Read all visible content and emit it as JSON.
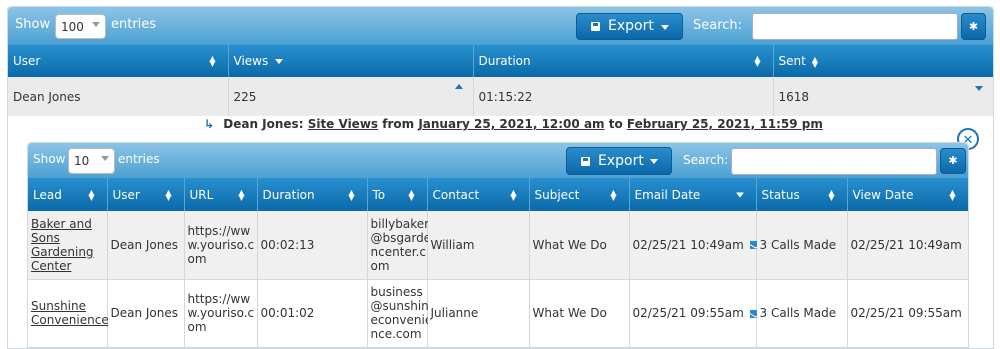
{
  "outer_toolbar": {
    "show_label": "Show",
    "entries_value": "100",
    "entries_label": "entries",
    "export_label": "Export",
    "search_label": "Search:",
    "search_value": ""
  },
  "outer_table": {
    "columns": [
      "User",
      "Views",
      "Duration",
      "Sent"
    ],
    "row": {
      "user": "Dean Jones",
      "views": "225",
      "duration": "01:15:22",
      "sent": "1618"
    }
  },
  "detail": {
    "user": "Dean Jones:",
    "metric": "Site Views",
    "from_word": "from",
    "start": "January 25, 2021, 12:00 am",
    "to_word": "to",
    "end": "February 25, 2021, 11:59 pm"
  },
  "inner_toolbar": {
    "show_label": "Show",
    "entries_value": "10",
    "entries_label": "entries",
    "export_label": "Export",
    "search_label": "Search:",
    "search_value": ""
  },
  "inner_table": {
    "columns": [
      "Lead",
      "User",
      "URL",
      "Duration",
      "To",
      "Contact",
      "Subject",
      "Email Date",
      "Status",
      "View Date"
    ],
    "rows": [
      {
        "lead": [
          "Baker and",
          "Sons",
          "Gardening",
          "Center"
        ],
        "user": "Dean Jones",
        "url": [
          "https://ww",
          "w.youriso.c",
          "om"
        ],
        "duration": "00:02:13",
        "to": [
          "billybaker",
          "@bsgarde",
          "ncenter.c",
          "om"
        ],
        "contact": "William",
        "subject": "What We Do",
        "email_date": "02/25/21 10:49am",
        "status": "3 Calls Made",
        "view_date": "02/25/21 10:49am"
      },
      {
        "lead": [
          "Sunshine",
          "Convenience"
        ],
        "user": "Dean Jones",
        "url": [
          "https://ww",
          "w.youriso.c",
          "om"
        ],
        "duration": "00:01:02",
        "to": [
          "business",
          "@sunshin",
          "econvenie",
          "nce.com"
        ],
        "contact": "Julianne",
        "subject": "What We Do",
        "email_date": "02/25/21 09:55am",
        "status": "3 Calls Made",
        "view_date": "02/25/21 09:55am"
      }
    ]
  },
  "colors": {
    "header_blue": "#0b6aa9",
    "toolbar_blue": "#4ba0d2",
    "icon_blue": "#1a73b7"
  }
}
